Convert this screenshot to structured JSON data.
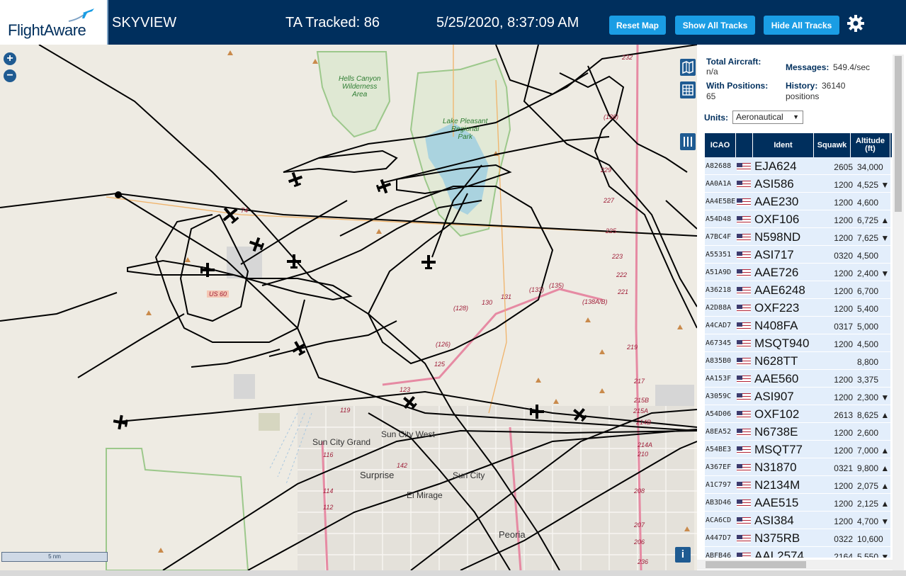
{
  "header": {
    "logo_text": "FlightAware",
    "app_title": "SKYVIEW",
    "tracked": "TA Tracked: 86",
    "clock": "5/25/2020, 8:37:09 AM",
    "buttons": {
      "reset": "Reset Map",
      "show": "Show All Tracks",
      "hide": "Hide All Tracks"
    }
  },
  "map": {
    "zoom_in": "+",
    "zoom_out": "−",
    "scale": "5 nm",
    "info": "i",
    "places": [
      {
        "name": "Sun City Grand"
      },
      {
        "name": "Sun City West"
      },
      {
        "name": "Surprise"
      },
      {
        "name": "Sun City"
      },
      {
        "name": "El Mirage"
      },
      {
        "name": "Peoria"
      }
    ],
    "parks": [
      {
        "name": "Hells Canyon\nWilderness\nArea"
      },
      {
        "name": "Lake Pleasant\nRegional\nPark"
      }
    ],
    "highway_labels": [
      "74",
      "US 60",
      "119",
      "116",
      "114",
      "112",
      "142",
      "130",
      "131",
      "(133)",
      "(135)",
      "(128)",
      "(126)",
      "125",
      "123",
      "229",
      "227",
      "225",
      "223",
      "222",
      "221",
      "219",
      "217",
      "215B",
      "215A",
      "214B",
      "214A",
      "210",
      "208",
      "207",
      "206",
      "236",
      "232",
      "(136)",
      "(138A/B)"
    ]
  },
  "panel": {
    "total_aircraft_label": "Total Aircraft:",
    "total_aircraft_value": "n/a",
    "messages_label": "Messages:",
    "messages_value": "549.4/sec",
    "positions_label": "With Positions:",
    "positions_value": "65",
    "history_label": "History:",
    "history_value": "36140",
    "history_unit": "positions",
    "units_label": "Units:",
    "units_value": "Aeronautical",
    "columns": [
      "ICAO",
      "",
      "Ident",
      "Squawk",
      "Altitude (ft)"
    ],
    "rows": [
      {
        "icao": "A82688",
        "ident": "EJA624",
        "squawk": "2605",
        "alt": "34,000"
      },
      {
        "icao": "AA0A1A",
        "ident": "ASI586",
        "squawk": "1200",
        "alt": "4,525 ▼"
      },
      {
        "icao": "AA4E5BE",
        "ident": "AAE230",
        "squawk": "1200",
        "alt": "4,600"
      },
      {
        "icao": "A54D48",
        "ident": "OXF106",
        "squawk": "1200",
        "alt": "6,725 ▲"
      },
      {
        "icao": "A7BC4F",
        "ident": "N598ND",
        "squawk": "1200",
        "alt": "7,625 ▼"
      },
      {
        "icao": "A55351",
        "ident": "ASI717",
        "squawk": "0320",
        "alt": "4,500"
      },
      {
        "icao": "A51A9D",
        "ident": "AAE726",
        "squawk": "1200",
        "alt": "2,400 ▼"
      },
      {
        "icao": "A36218",
        "ident": "AAE6248",
        "squawk": "1200",
        "alt": "6,700"
      },
      {
        "icao": "A2D88A",
        "ident": "OXF223",
        "squawk": "1200",
        "alt": "5,400"
      },
      {
        "icao": "A4CAD7",
        "ident": "N408FA",
        "squawk": "0317",
        "alt": "5,000"
      },
      {
        "icao": "A67345",
        "ident": "MSQT940",
        "squawk": "1200",
        "alt": "4,500"
      },
      {
        "icao": "A835B0",
        "ident": "N628TT",
        "squawk": "",
        "alt": "8,800"
      },
      {
        "icao": "AA153F",
        "ident": "AAE560",
        "squawk": "1200",
        "alt": "3,375"
      },
      {
        "icao": "A3059C",
        "ident": "ASI907",
        "squawk": "1200",
        "alt": "2,300 ▼"
      },
      {
        "icao": "A54D06",
        "ident": "OXF102",
        "squawk": "2613",
        "alt": "8,625 ▲"
      },
      {
        "icao": "A8EA52",
        "ident": "N6738E",
        "squawk": "1200",
        "alt": "2,600"
      },
      {
        "icao": "A54BE3",
        "ident": "MSQT77",
        "squawk": "1200",
        "alt": "7,000 ▲"
      },
      {
        "icao": "A367EF",
        "ident": "N31870",
        "squawk": "0321",
        "alt": "9,800 ▲"
      },
      {
        "icao": "A1C797",
        "ident": "N2134M",
        "squawk": "1200",
        "alt": "2,075 ▲"
      },
      {
        "icao": "AB3D46",
        "ident": "AAE515",
        "squawk": "1200",
        "alt": "2,125 ▲"
      },
      {
        "icao": "ACA6CD",
        "ident": "ASI384",
        "squawk": "1200",
        "alt": "4,700 ▼"
      },
      {
        "icao": "A447D7",
        "ident": "N375RB",
        "squawk": "0322",
        "alt": "10,600"
      },
      {
        "icao": "ABFB46",
        "ident": "AAL2574",
        "squawk": "2164",
        "alt": "5,550 ▼"
      }
    ]
  },
  "colors": {
    "header_bg": "#002f5d",
    "button_bg": "#1a9de4",
    "row_bg": "#e3eefb",
    "track": "#000000"
  }
}
